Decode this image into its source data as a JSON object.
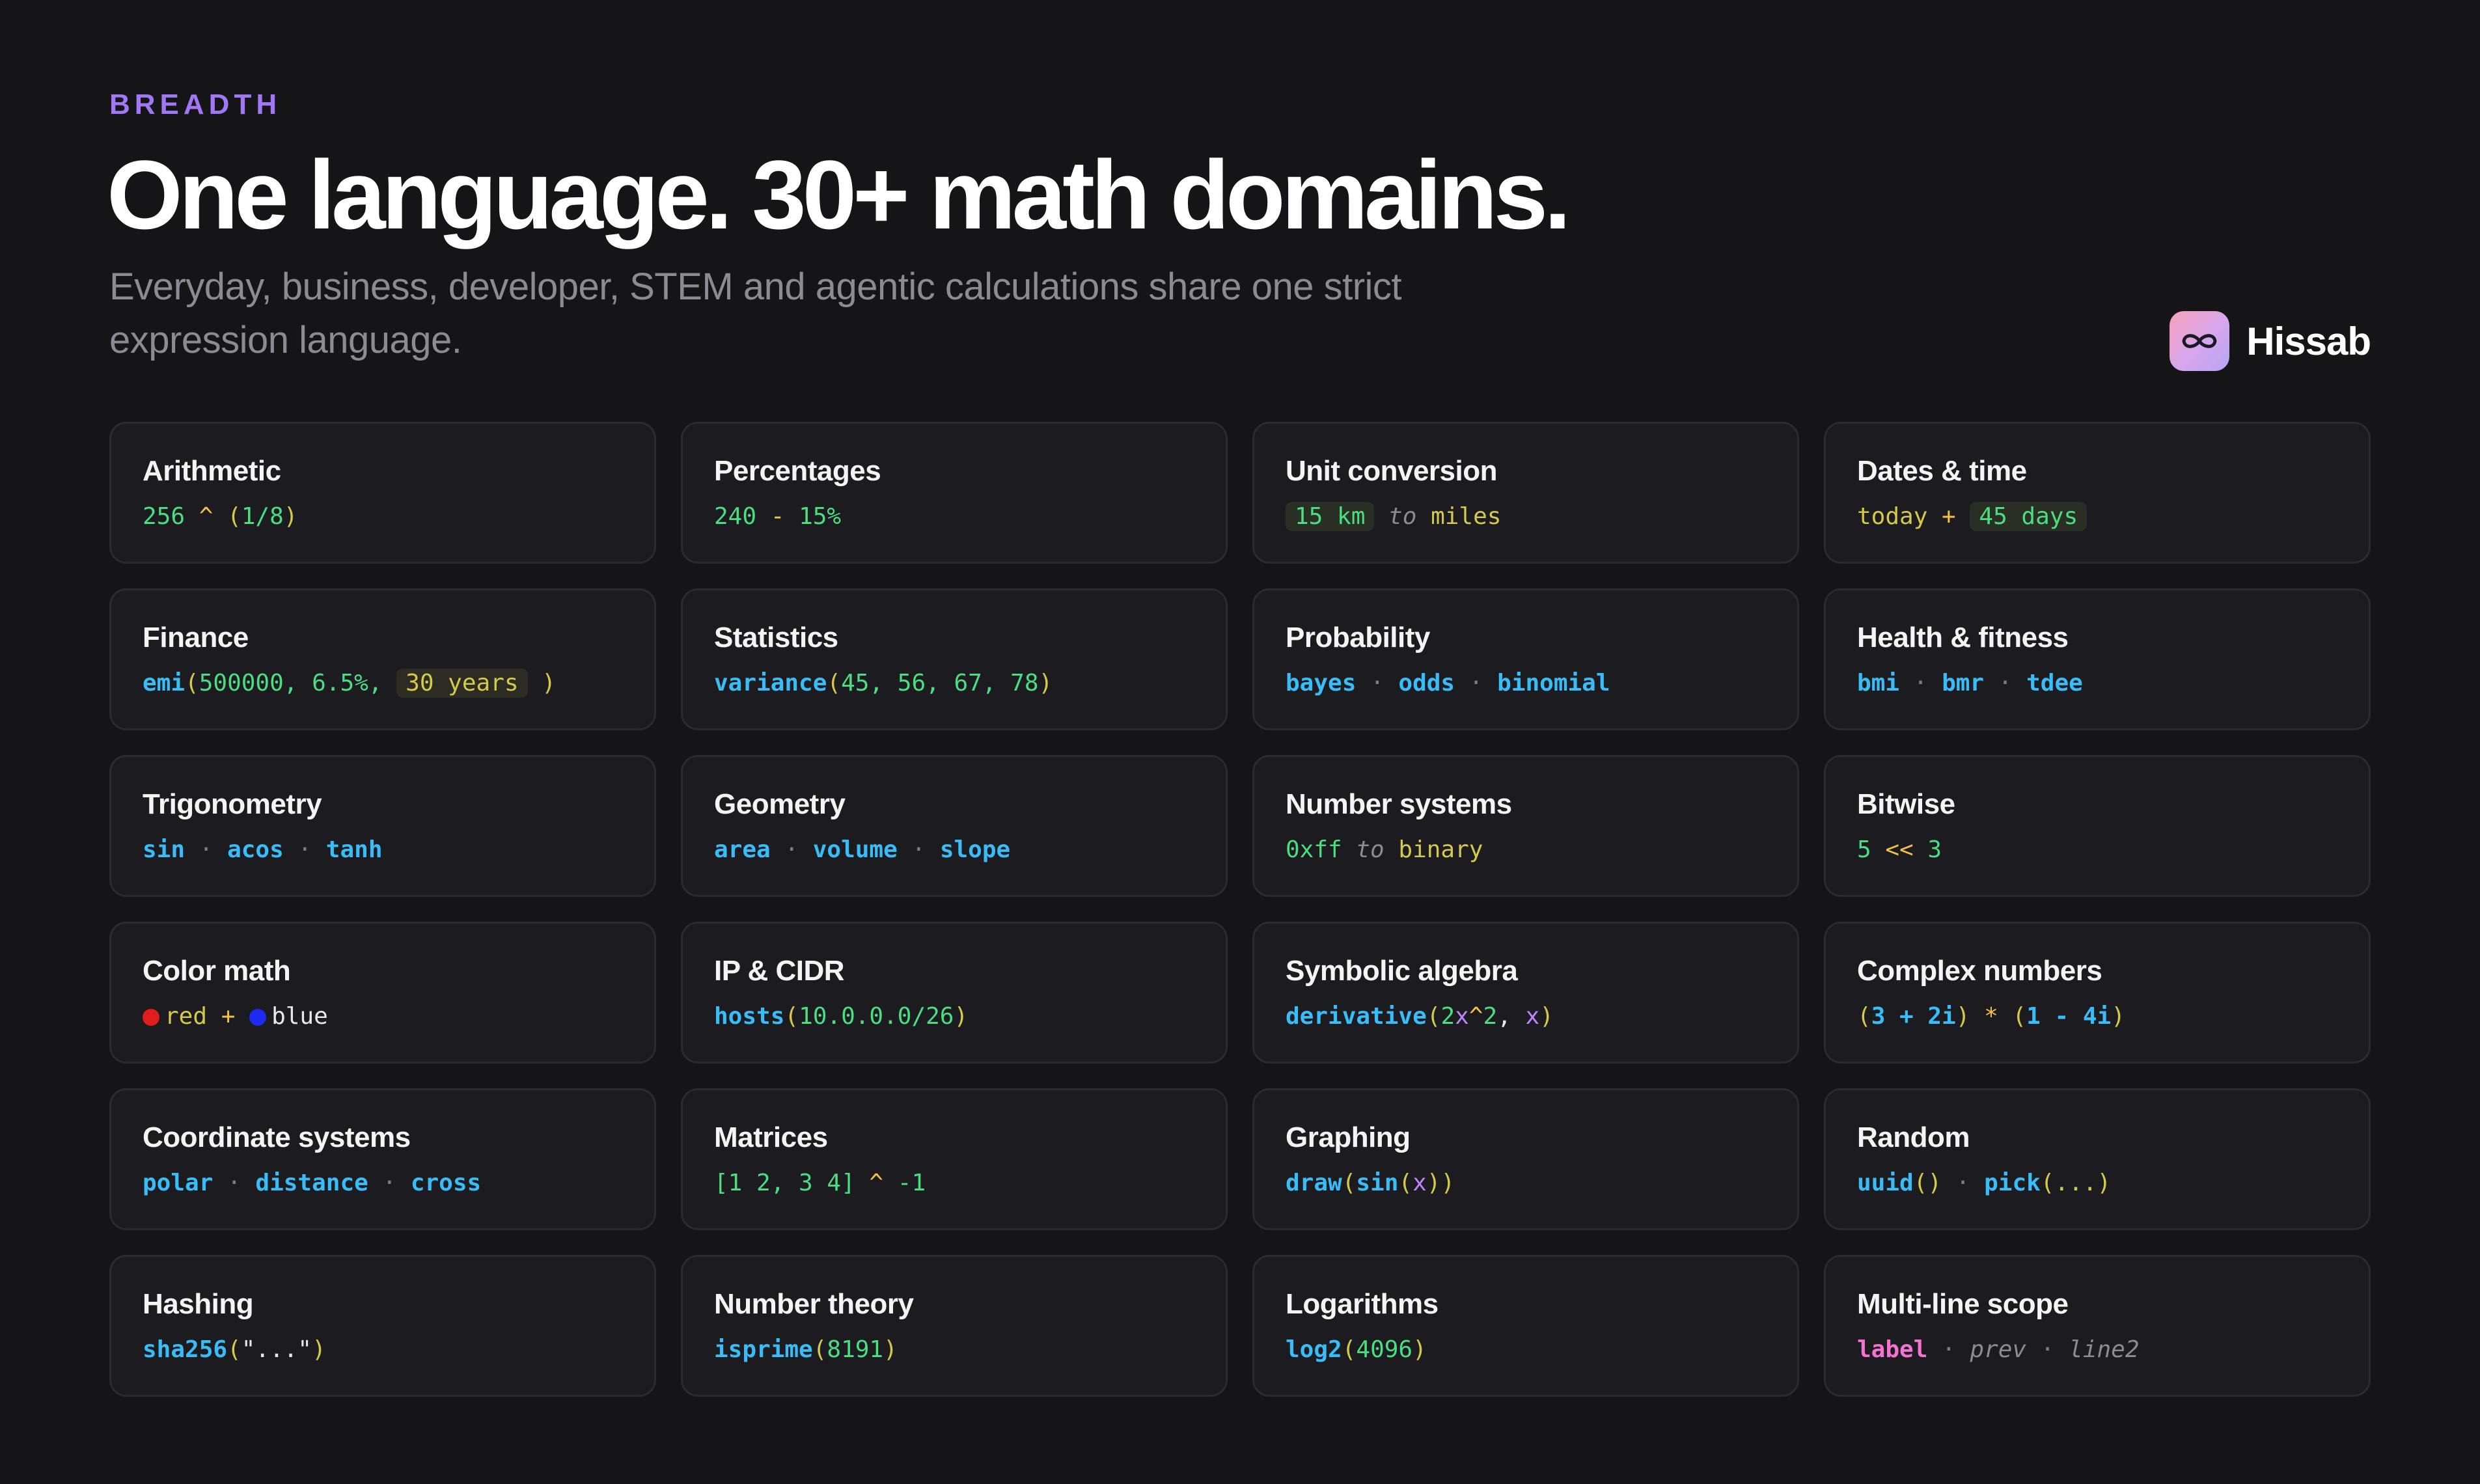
{
  "header": {
    "eyebrow": "BREADTH",
    "title": "One language. 30+ math domains.",
    "subtitle": "Everyday, business, developer, STEM and agentic calculations share one strict expression language."
  },
  "brand": {
    "name": "Hissab",
    "logo_icon": "infinity-icon",
    "accent": "#a277f5"
  },
  "colors": {
    "background": "#151518",
    "card": "#1c1c20",
    "function": "#38bdf8",
    "number": "#4ade80",
    "operator": "#f5c04a",
    "label": "#f472d0"
  },
  "cards": [
    {
      "title": "Arithmetic",
      "tokens": [
        [
          "t-num",
          "256"
        ],
        [
          "t-op",
          " ^ "
        ],
        [
          "t-paren",
          "("
        ],
        [
          "t-num",
          "1/8"
        ],
        [
          "t-paren",
          ")"
        ]
      ]
    },
    {
      "title": "Percentages",
      "tokens": [
        [
          "t-num",
          "240"
        ],
        [
          "t-op",
          " - "
        ],
        [
          "t-num",
          "15%"
        ]
      ]
    },
    {
      "title": "Unit conversion",
      "tokens": [
        [
          "t-pill-green",
          "15 km"
        ],
        [
          "t-kw",
          " to "
        ],
        [
          "t-unit",
          "miles"
        ]
      ]
    },
    {
      "title": "Dates & time",
      "tokens": [
        [
          "t-unit",
          "today"
        ],
        [
          "t-op",
          " + "
        ],
        [
          "t-pill-green",
          "45 days"
        ]
      ]
    },
    {
      "title": "Finance",
      "tokens": [
        [
          "t-fn",
          "emi"
        ],
        [
          "t-paren",
          "("
        ],
        [
          "t-num",
          "500000, 6.5%, "
        ],
        [
          "t-pill",
          "30 years"
        ],
        [
          "t-paren",
          " )"
        ]
      ]
    },
    {
      "title": "Statistics",
      "tokens": [
        [
          "t-fn",
          "variance"
        ],
        [
          "t-paren",
          "("
        ],
        [
          "t-num",
          "45, 56, 67, 78"
        ],
        [
          "t-paren",
          ")"
        ]
      ]
    },
    {
      "title": "Probability",
      "tokens": [
        [
          "t-fn",
          "bayes"
        ],
        [
          "t-sep",
          " · "
        ],
        [
          "t-fn",
          "odds"
        ],
        [
          "t-sep",
          " · "
        ],
        [
          "t-fn",
          "binomial"
        ]
      ]
    },
    {
      "title": "Health & fitness",
      "tokens": [
        [
          "t-fn",
          "bmi"
        ],
        [
          "t-sep",
          " · "
        ],
        [
          "t-fn",
          "bmr"
        ],
        [
          "t-sep",
          " · "
        ],
        [
          "t-fn",
          "tdee"
        ]
      ]
    },
    {
      "title": "Trigonometry",
      "tokens": [
        [
          "t-fn",
          "sin"
        ],
        [
          "t-sep",
          " · "
        ],
        [
          "t-fn",
          "acos"
        ],
        [
          "t-sep",
          " · "
        ],
        [
          "t-fn",
          "tanh"
        ]
      ]
    },
    {
      "title": "Geometry",
      "tokens": [
        [
          "t-fn",
          "area"
        ],
        [
          "t-sep",
          " · "
        ],
        [
          "t-fn",
          "volume"
        ],
        [
          "t-sep",
          " · "
        ],
        [
          "t-fn",
          "slope"
        ]
      ]
    },
    {
      "title": "Number systems",
      "tokens": [
        [
          "t-num",
          "0xff"
        ],
        [
          "t-kw",
          " to "
        ],
        [
          "t-unit",
          "binary"
        ]
      ]
    },
    {
      "title": "Bitwise",
      "tokens": [
        [
          "t-num",
          "5"
        ],
        [
          "t-op",
          " << "
        ],
        [
          "t-num",
          "3"
        ]
      ]
    },
    {
      "title": "Color math",
      "tokens": [
        [
          "dot-red",
          ""
        ],
        [
          "t-unit",
          "red"
        ],
        [
          "t-op",
          " + "
        ],
        [
          "dot-blue",
          ""
        ],
        [
          "t-str",
          "blue"
        ]
      ]
    },
    {
      "title": "IP & CIDR",
      "tokens": [
        [
          "t-fn",
          "hosts"
        ],
        [
          "t-paren",
          "("
        ],
        [
          "t-num",
          "10.0.0.0/26"
        ],
        [
          "t-paren",
          ")"
        ]
      ]
    },
    {
      "title": "Symbolic algebra",
      "tokens": [
        [
          "t-fn",
          "derivative"
        ],
        [
          "t-paren",
          "("
        ],
        [
          "t-num",
          "2"
        ],
        [
          "t-var",
          "x"
        ],
        [
          "t-op",
          "^"
        ],
        [
          "t-num",
          "2"
        ],
        [
          "t-str",
          ", "
        ],
        [
          "t-var",
          "x"
        ],
        [
          "t-paren",
          ")"
        ]
      ]
    },
    {
      "title": "Complex numbers",
      "tokens": [
        [
          "t-paren",
          "("
        ],
        [
          "t-fn",
          "3 + 2i"
        ],
        [
          "t-paren",
          ")"
        ],
        [
          "t-op",
          " * "
        ],
        [
          "t-paren",
          "("
        ],
        [
          "t-fn",
          "1 - 4i"
        ],
        [
          "t-paren",
          ")"
        ]
      ]
    },
    {
      "title": "Coordinate systems",
      "tokens": [
        [
          "t-fn",
          "polar"
        ],
        [
          "t-sep",
          " · "
        ],
        [
          "t-fn",
          "distance"
        ],
        [
          "t-sep",
          " · "
        ],
        [
          "t-fn",
          "cross"
        ]
      ]
    },
    {
      "title": "Matrices",
      "tokens": [
        [
          "t-num",
          "[1 2, 3 4]"
        ],
        [
          "t-op",
          " ^ "
        ],
        [
          "t-num",
          "-1"
        ]
      ]
    },
    {
      "title": "Graphing",
      "tokens": [
        [
          "t-fn",
          "draw"
        ],
        [
          "t-paren",
          "("
        ],
        [
          "t-fn",
          "sin"
        ],
        [
          "t-paren",
          "("
        ],
        [
          "t-var",
          "x"
        ],
        [
          "t-paren",
          "))"
        ]
      ]
    },
    {
      "title": "Random",
      "tokens": [
        [
          "t-fn",
          "uuid"
        ],
        [
          "t-paren",
          "()"
        ],
        [
          "t-sep",
          " · "
        ],
        [
          "t-fn",
          "pick"
        ],
        [
          "t-paren",
          "(...)"
        ]
      ]
    },
    {
      "title": "Hashing",
      "tokens": [
        [
          "t-fn",
          "sha256"
        ],
        [
          "t-paren",
          "("
        ],
        [
          "t-str",
          "\"...\""
        ],
        [
          "t-paren",
          ")"
        ]
      ]
    },
    {
      "title": "Number theory",
      "tokens": [
        [
          "t-fn",
          "isprime"
        ],
        [
          "t-paren",
          "("
        ],
        [
          "t-num",
          "8191"
        ],
        [
          "t-paren",
          ")"
        ]
      ]
    },
    {
      "title": "Logarithms",
      "tokens": [
        [
          "t-fn",
          "log2"
        ],
        [
          "t-paren",
          "("
        ],
        [
          "t-num",
          "4096"
        ],
        [
          "t-paren",
          ")"
        ]
      ]
    },
    {
      "title": "Multi-line scope",
      "tokens": [
        [
          "t-label",
          "label"
        ],
        [
          "t-sep",
          " · "
        ],
        [
          "t-muted",
          "prev"
        ],
        [
          "t-sep",
          " · "
        ],
        [
          "t-muted",
          "line2"
        ]
      ]
    }
  ]
}
